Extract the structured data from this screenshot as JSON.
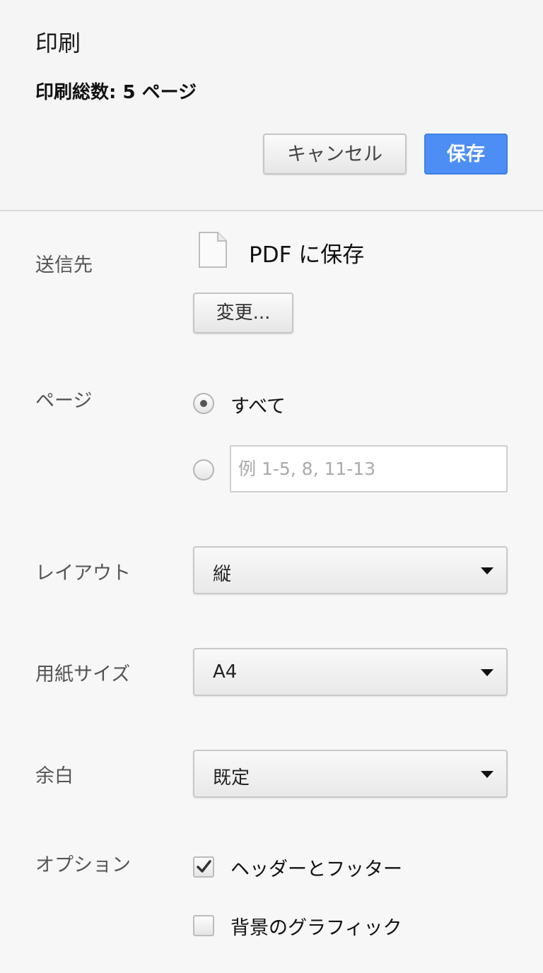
{
  "header": {
    "title": "印刷",
    "summary": "印刷総数: 5 ページ",
    "cancel_label": "キャンセル",
    "save_label": "保存"
  },
  "destination": {
    "label": "送信先",
    "value": "PDF に保存",
    "change_label": "変更..."
  },
  "pages": {
    "label": "ページ",
    "all_label": "すべて",
    "all_selected": true,
    "range_placeholder": "例 1-5, 8, 11-13",
    "range_value": ""
  },
  "layout": {
    "label": "レイアウト",
    "value": "縦"
  },
  "paper_size": {
    "label": "用紙サイズ",
    "value": "A4"
  },
  "margins": {
    "label": "余白",
    "value": "既定"
  },
  "options": {
    "label": "オプション",
    "header_footer_label": "ヘッダーとフッター",
    "header_footer_checked": true,
    "background_label": "背景のグラフィック",
    "background_checked": false
  },
  "colors": {
    "primary": "#4d8ef5",
    "background": "#f7f7f7"
  }
}
